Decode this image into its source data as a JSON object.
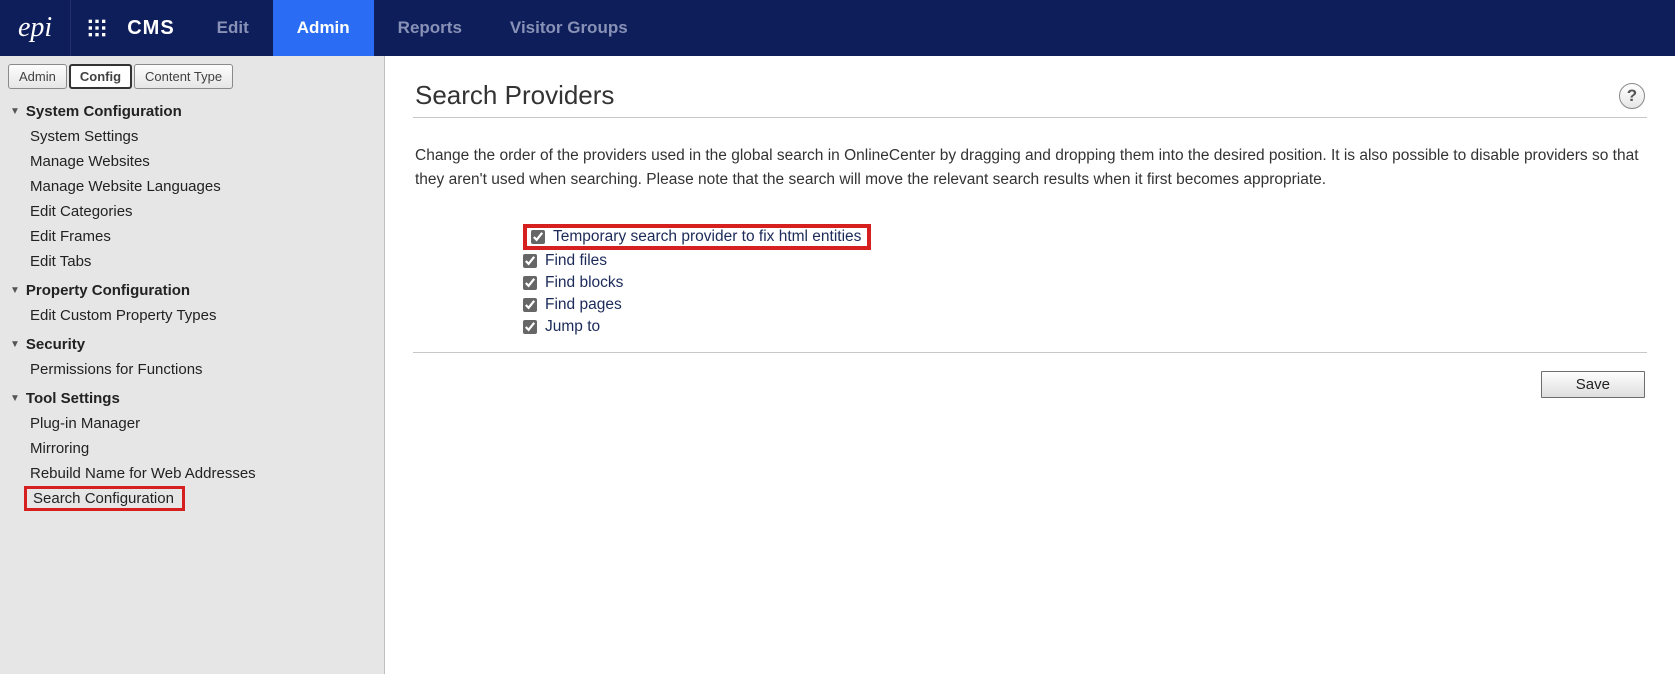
{
  "topnav": {
    "logo_text": "epi",
    "brand": "CMS",
    "items": [
      {
        "label": "Edit",
        "active": false
      },
      {
        "label": "Admin",
        "active": true
      },
      {
        "label": "Reports",
        "active": false
      },
      {
        "label": "Visitor Groups",
        "active": false
      }
    ]
  },
  "sidebar": {
    "subtabs": [
      {
        "label": "Admin",
        "active": false
      },
      {
        "label": "Config",
        "active": true
      },
      {
        "label": "Content Type",
        "active": false
      }
    ],
    "sections": [
      {
        "title": "System Configuration",
        "items": [
          {
            "label": "System Settings"
          },
          {
            "label": "Manage Websites"
          },
          {
            "label": "Manage Website Languages"
          },
          {
            "label": "Edit Categories"
          },
          {
            "label": "Edit Frames"
          },
          {
            "label": "Edit Tabs"
          }
        ]
      },
      {
        "title": "Property Configuration",
        "items": [
          {
            "label": "Edit Custom Property Types"
          }
        ]
      },
      {
        "title": "Security",
        "items": [
          {
            "label": "Permissions for Functions"
          }
        ]
      },
      {
        "title": "Tool Settings",
        "items": [
          {
            "label": "Plug-in Manager"
          },
          {
            "label": "Mirroring"
          },
          {
            "label": "Rebuild Name for Web Addresses"
          },
          {
            "label": "Search Configuration",
            "highlighted": true
          }
        ]
      }
    ]
  },
  "main": {
    "title": "Search Providers",
    "help_tooltip": "?",
    "description": "Change the order of the providers used in the global search in OnlineCenter by dragging and dropping them into the desired position. It is also possible to disable providers so that they aren't used when searching. Please note that the search will move the relevant search results when it first becomes appropriate.",
    "providers": [
      {
        "label": "Temporary search provider to fix html entities",
        "checked": true,
        "highlighted": true
      },
      {
        "label": "Find files",
        "checked": true
      },
      {
        "label": "Find blocks",
        "checked": true
      },
      {
        "label": "Find pages",
        "checked": true
      },
      {
        "label": "Jump to",
        "checked": true
      }
    ],
    "save_label": "Save"
  }
}
